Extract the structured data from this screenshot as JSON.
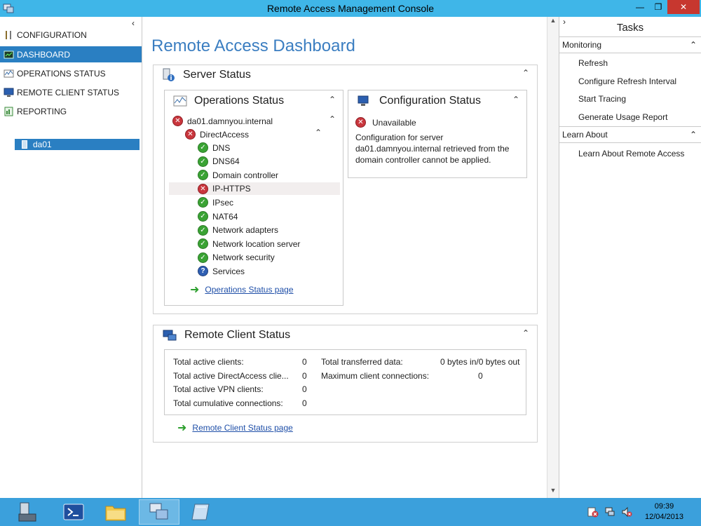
{
  "window": {
    "title": "Remote Access Management Console",
    "minimize_label": "—",
    "maximize_label": "❐",
    "close_label": "✕"
  },
  "nav": {
    "collapse_glyph": "‹",
    "items": [
      {
        "label": "CONFIGURATION",
        "icon": "wrench-icon"
      },
      {
        "label": "DASHBOARD",
        "icon": "dashboard-icon"
      },
      {
        "label": "OPERATIONS STATUS",
        "icon": "chart-icon"
      },
      {
        "label": "REMOTE CLIENT STATUS",
        "icon": "monitor-icon"
      },
      {
        "label": "REPORTING",
        "icon": "report-icon"
      }
    ],
    "server": "da01"
  },
  "page_title": "Remote Access Dashboard",
  "server_status": {
    "title": "Server Status",
    "operations": {
      "title": "Operations Status",
      "server": "da01.damnyou.internal",
      "group": "DirectAccess",
      "components": [
        {
          "label": "DNS",
          "status": "ok"
        },
        {
          "label": "DNS64",
          "status": "ok"
        },
        {
          "label": "Domain controller",
          "status": "ok"
        },
        {
          "label": "IP-HTTPS",
          "status": "err"
        },
        {
          "label": "IPsec",
          "status": "ok"
        },
        {
          "label": "NAT64",
          "status": "ok"
        },
        {
          "label": "Network adapters",
          "status": "ok"
        },
        {
          "label": "Network location server",
          "status": "ok"
        },
        {
          "label": "Network security",
          "status": "ok"
        },
        {
          "label": "Services",
          "status": "unk"
        }
      ],
      "link": "Operations Status page"
    },
    "configuration": {
      "title": "Configuration Status",
      "state": "Unavailable",
      "message": "Configuration for server da01.damnyou.internal retrieved from the domain controller cannot be applied."
    }
  },
  "remote_client": {
    "title": "Remote Client Status",
    "left_stats": [
      {
        "label": "Total active clients:",
        "value": "0"
      },
      {
        "label": "Total active DirectAccess clie...",
        "value": "0"
      },
      {
        "label": "Total active VPN clients:",
        "value": "0"
      },
      {
        "label": "Total cumulative connections:",
        "value": "0"
      }
    ],
    "right_stats": [
      {
        "label": "Total transferred data:",
        "value": "0 bytes in/0 bytes out"
      },
      {
        "label": "Maximum client connections:",
        "value": "0"
      }
    ],
    "link": "Remote Client Status page"
  },
  "tasks": {
    "title": "Tasks",
    "expand_glyph": "›",
    "sections": [
      {
        "label": "Monitoring",
        "items": [
          "Refresh",
          "Configure Refresh Interval",
          "Start Tracing",
          "Generate Usage Report"
        ]
      },
      {
        "label": "Learn About",
        "items": [
          "Learn About Remote Access"
        ]
      }
    ]
  },
  "clock": {
    "time": "09:39",
    "date": "12/04/2013"
  },
  "colors": {
    "titlebar": "#3fb6e8",
    "accent": "#2a7fc2",
    "heading": "#3b7ec1",
    "taskbar": "#3ba0dc"
  }
}
